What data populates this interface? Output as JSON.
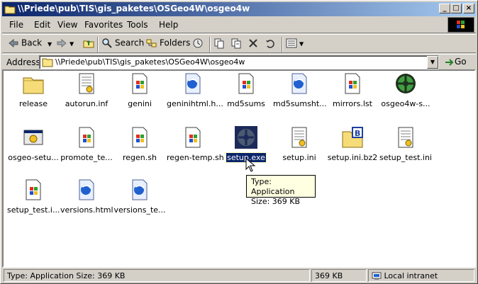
{
  "window": {
    "title": "\\\\Priede\\pub\\TIS\\gis_paketes\\OSGeo4W\\osgeo4w"
  },
  "menu": [
    {
      "label": "File"
    },
    {
      "label": "Edit"
    },
    {
      "label": "View"
    },
    {
      "label": "Favorites"
    },
    {
      "label": "Tools"
    },
    {
      "label": "Help"
    }
  ],
  "toolbar": {
    "back_label": "Back",
    "search_label": "Search",
    "folders_label": "Folders"
  },
  "address": {
    "label": "Address",
    "path": "\\\\Priede\\pub\\TIS\\gis_paketes\\OSGeo4W\\osgeo4w",
    "go_label": "Go"
  },
  "files": [
    {
      "name": "release",
      "icon": "folder-icon"
    },
    {
      "name": "autorun.inf",
      "icon": "config-file-icon"
    },
    {
      "name": "genini",
      "icon": "windows-file-icon"
    },
    {
      "name": "geninihtml.h...",
      "icon": "html-document-icon"
    },
    {
      "name": "md5sums",
      "icon": "windows-file-icon"
    },
    {
      "name": "md5sumsht...",
      "icon": "html-document-icon"
    },
    {
      "name": "mirrors.lst",
      "icon": "windows-file-icon"
    },
    {
      "name": "osgeo4w-s...",
      "icon": "osgeo-setup-icon"
    },
    {
      "name": "osgeo-setu...",
      "icon": "program-icon"
    },
    {
      "name": "promote_te...",
      "icon": "windows-file-icon"
    },
    {
      "name": "regen.sh",
      "icon": "windows-file-icon"
    },
    {
      "name": "regen-temp.sh",
      "icon": "windows-file-icon"
    },
    {
      "name": "setup.exe",
      "icon": "osgeo-setup-icon"
    },
    {
      "name": "setup.ini",
      "icon": "config-file-icon"
    },
    {
      "name": "setup.ini.bz2",
      "icon": "archive-folder-icon"
    },
    {
      "name": "setup_test.ini",
      "icon": "config-file-icon"
    },
    {
      "name": "setup_test.i...",
      "icon": "windows-file-icon"
    },
    {
      "name": "versions.html",
      "icon": "html-document-icon"
    },
    {
      "name": "versions_te...",
      "icon": "html-document-icon"
    }
  ],
  "selected_file": "setup.exe",
  "tooltip": {
    "line1": "Type: Application",
    "line2": "Size: 369 KB"
  },
  "status": {
    "text": "Type: Application Size: 369 KB",
    "size": "369 KB",
    "zone": "Local intranet"
  }
}
